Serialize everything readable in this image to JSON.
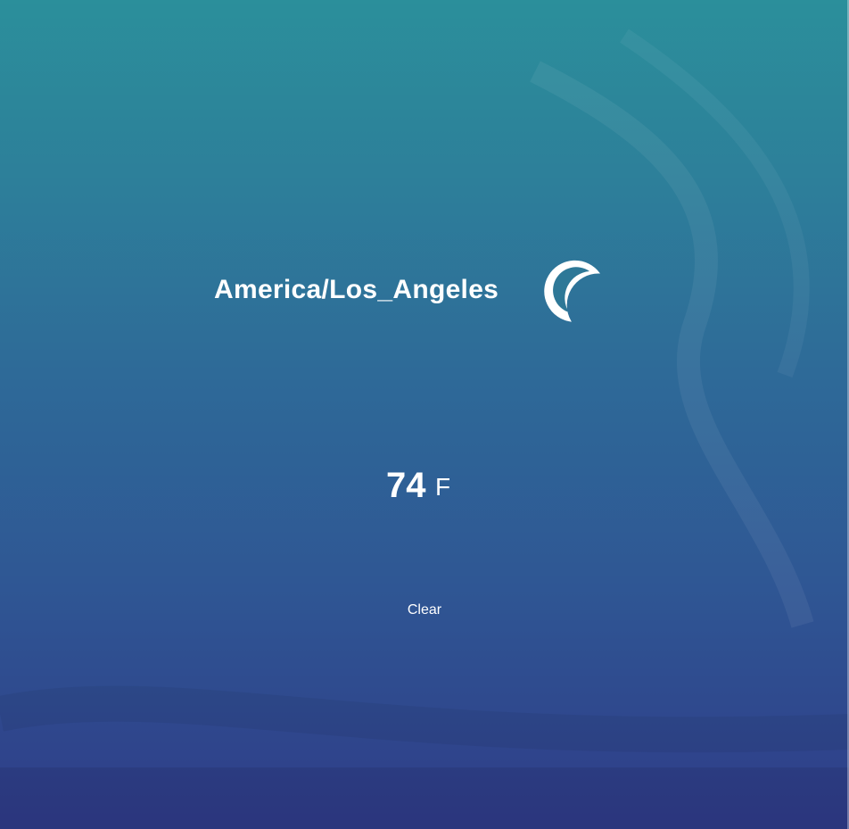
{
  "location": {
    "name": "America/Los_Angeles"
  },
  "weather": {
    "icon": "clear-night-moon-icon",
    "temperature": "74",
    "unit": "F",
    "condition": "Clear"
  },
  "colors": {
    "gradient_top": "#2b8f9b",
    "gradient_bottom": "#2f3c88",
    "text": "#ffffff"
  }
}
